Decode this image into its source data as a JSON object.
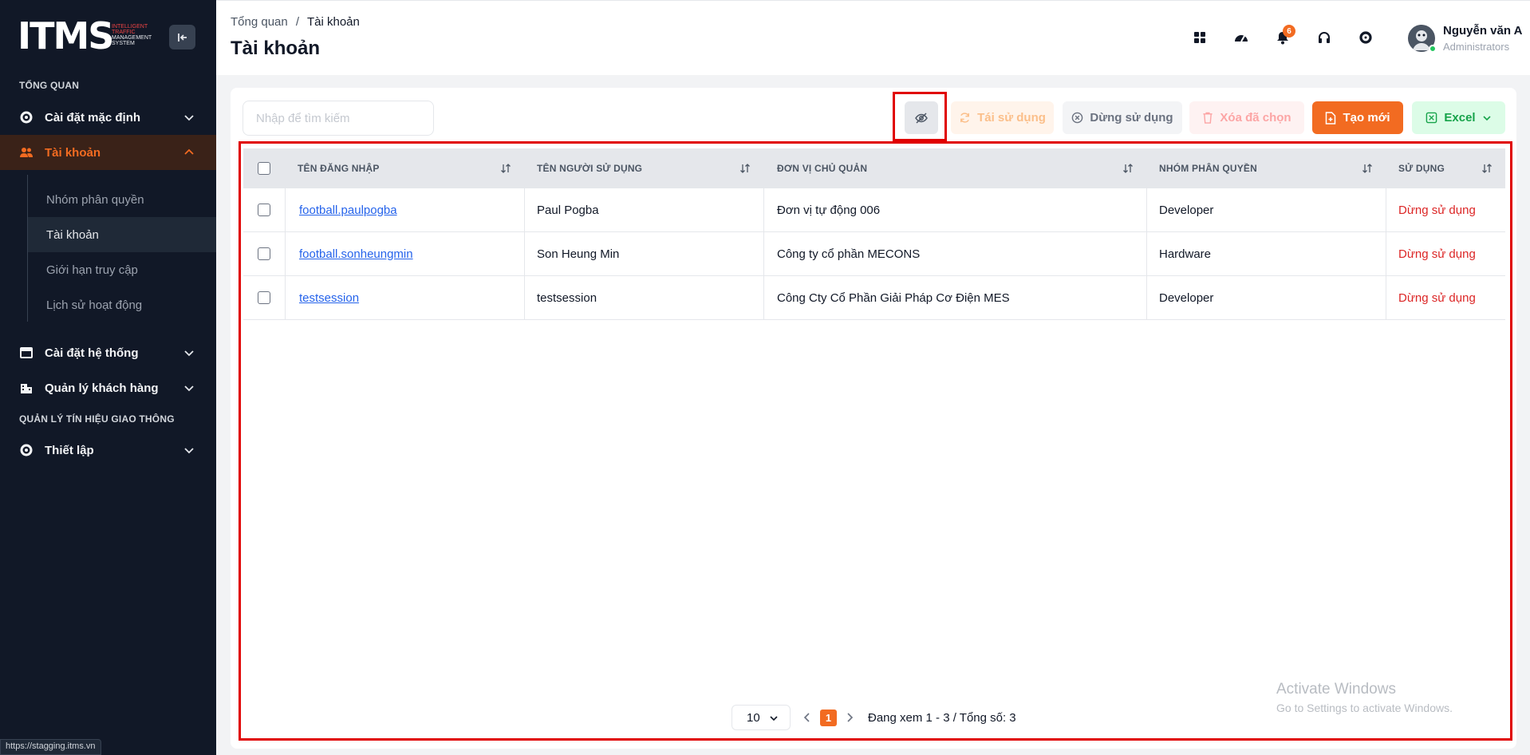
{
  "app": {
    "logo_text": "ITMS",
    "logo_sub": [
      "INTELLIGENT",
      "TRAFFIC",
      "MANAGEMENT",
      "SYSTEM"
    ]
  },
  "sidebar": {
    "section_overview": "TỔNG QUAN",
    "section_signal": "QUẢN LÝ TÍN HIỆU GIAO THÔNG",
    "items": [
      {
        "label": "Cài đặt mặc định",
        "icon": "gear-icon",
        "expanded": false
      },
      {
        "label": "Tài khoản",
        "icon": "users-icon",
        "expanded": true,
        "active": true
      },
      {
        "label": "Cài đặt hệ thống",
        "icon": "window-icon",
        "expanded": false
      },
      {
        "label": "Quản lý khách hàng",
        "icon": "building-icon",
        "expanded": false
      },
      {
        "label": "Thiết lập",
        "icon": "gear-icon",
        "expanded": false
      }
    ],
    "subitems": [
      {
        "label": "Nhóm phân quyền"
      },
      {
        "label": "Tài khoản",
        "active": true
      },
      {
        "label": "Giới hạn truy cập"
      },
      {
        "label": "Lịch sử hoạt động"
      }
    ]
  },
  "header": {
    "breadcrumb_root": "Tổng quan",
    "breadcrumb_sep": "/",
    "breadcrumb_current": "Tài khoản",
    "title": "Tài khoản",
    "notification_count": "6",
    "user_name": "Nguyễn văn A",
    "user_role": "Administrators"
  },
  "toolbar": {
    "search_placeholder": "Nhập để tìm kiếm",
    "reuse_label": "Tái sử dụng",
    "stop_label": "Dừng sử dụng",
    "delete_label": "Xóa đã chọn",
    "new_label": "Tạo mới",
    "excel_label": "Excel"
  },
  "table": {
    "columns": [
      "TÊN ĐĂNG NHẬP",
      "TÊN NGƯỜI SỬ DỤNG",
      "ĐƠN VỊ CHỦ QUẢN",
      "NHÓM PHÂN QUYỀN",
      "SỬ DỤNG"
    ],
    "rows": [
      {
        "username": "football.paulpogba",
        "fullname": "Paul Pogba",
        "unit": "Đơn vị tự động 006",
        "group": "Developer",
        "status": "Dừng sử dụng"
      },
      {
        "username": "football.sonheungmin",
        "fullname": "Son Heung Min",
        "unit": "Công ty cổ phần MECONS",
        "group": "Hardware",
        "status": "Dừng sử dụng"
      },
      {
        "username": "testsession",
        "fullname": "testsession",
        "unit": "Công Cty Cổ Phần Giải Pháp Cơ Điện MES",
        "group": "Developer",
        "status": "Dừng sử dụng"
      }
    ]
  },
  "pagination": {
    "page_size": "10",
    "current_page": "1",
    "info": "Đang xem 1 - 3 / Tổng số: 3"
  },
  "watermark": {
    "line1": "Activate Windows",
    "line2": "Go to Settings to activate Windows."
  },
  "status_bar": {
    "url": "https://stagging.itms.vn"
  },
  "colors": {
    "brand": "#f26b21",
    "sidebar_bg": "#111827",
    "status_red": "#dc2626",
    "link_blue": "#2563eb",
    "excel_green": "#16a34a",
    "highlight_red": "#e00000"
  }
}
